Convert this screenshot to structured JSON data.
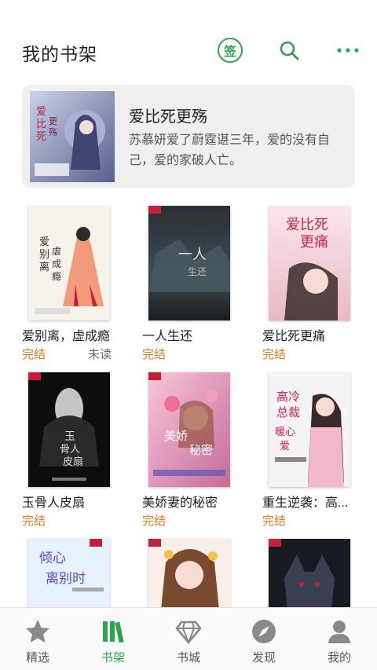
{
  "header": {
    "title": "我的书架",
    "sign_label": "签",
    "search_icon": "search-icon",
    "more_icon": "more-icon",
    "accent_color": "#2ea44f"
  },
  "featured": {
    "title": "爱比死更殇",
    "description": "苏慕妍爱了蔚霆谌三年，爱的没有自己，爱的家破人亡。",
    "cover_text": "爱比死更殇"
  },
  "books": [
    {
      "title": "爱别离，虚成瘾",
      "status": "完结",
      "read_state": "未读",
      "cover_text": "爱别离 虐成瘾"
    },
    {
      "title": "一人生还",
      "status": "完结",
      "read_state": "",
      "cover_text": "一人生还"
    },
    {
      "title": "爱比死更痛",
      "status": "完结",
      "read_state": "",
      "cover_text": "爱比死更痛"
    },
    {
      "title": "玉骨人皮扇",
      "status": "完结",
      "read_state": "",
      "cover_text": "玉骨人皮扇"
    },
    {
      "title": "美娇妻的秘密",
      "status": "完结",
      "read_state": "",
      "cover_text": "美娇妻的秘密"
    },
    {
      "title": "重生逆袭：高...",
      "status": "完结",
      "read_state": "",
      "cover_text": "高冷总裁 暖心爱"
    },
    {
      "title": "",
      "status": "",
      "read_state": "",
      "cover_text": "倾心 离别时"
    },
    {
      "title": "",
      "status": "",
      "read_state": "",
      "cover_text": ""
    },
    {
      "title": "",
      "status": "",
      "read_state": "",
      "cover_text": ""
    }
  ],
  "tabs": [
    {
      "label": "精选",
      "icon": "star-icon",
      "active": false
    },
    {
      "label": "书架",
      "icon": "bookshelf-icon",
      "active": true
    },
    {
      "label": "书城",
      "icon": "diamond-icon",
      "active": false
    },
    {
      "label": "发现",
      "icon": "compass-icon",
      "active": false
    },
    {
      "label": "我的",
      "icon": "user-icon",
      "active": false
    }
  ]
}
